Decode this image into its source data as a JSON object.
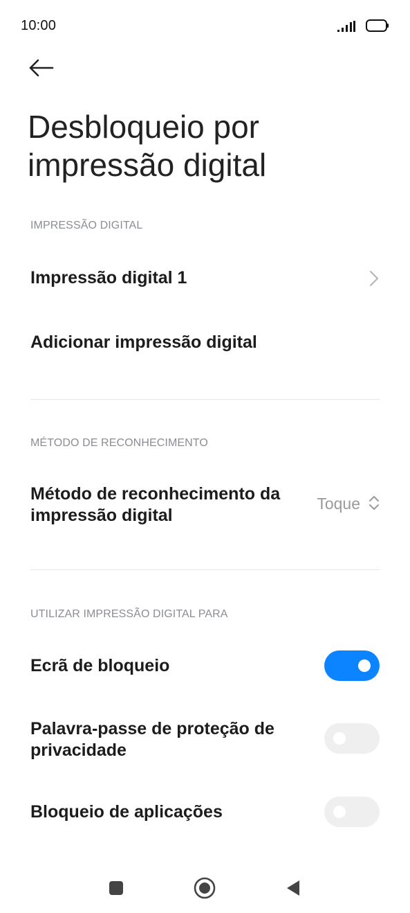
{
  "status_bar": {
    "time": "10:00",
    "icons": [
      "signal-icon",
      "battery-icon"
    ]
  },
  "header": {
    "back_icon": "back-arrow-icon",
    "title": "Desbloqueio por impressão digital"
  },
  "sections": {
    "fingerprint": {
      "header": "IMPRESSÃO DIGITAL",
      "items": [
        {
          "label": "Impressão digital 1",
          "icon": "chevron-right-icon"
        },
        {
          "label": "Adicionar impressão digital"
        }
      ]
    },
    "recognition": {
      "header": "MÉTODO DE RECONHECIMENTO",
      "items": [
        {
          "label": "Método de reconhecimento da impressão digital",
          "value": "Toque",
          "icon": "updown-chevron-icon"
        }
      ]
    },
    "use_for": {
      "header": "UTILIZAR IMPRESSÃO DIGITAL PARA",
      "items": [
        {
          "label": "Ecrã de bloqueio",
          "enabled": true
        },
        {
          "label": "Palavra-passe de proteção de privacidade",
          "enabled": false
        },
        {
          "label": "Bloqueio de aplicações",
          "enabled": false
        }
      ]
    }
  },
  "nav_bar": {
    "icons": [
      "recents-square-icon",
      "home-circle-icon",
      "back-triangle-icon"
    ]
  },
  "colors": {
    "accent": "#0d84ff",
    "toggle_off": "#efefef",
    "section_header": "#8a8d93",
    "secondary_text": "#9a9a9a"
  }
}
